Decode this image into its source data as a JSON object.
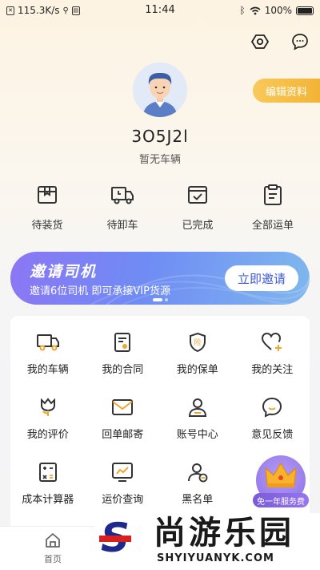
{
  "status_bar": {
    "speed": "115.3K/s",
    "time": "11:44",
    "battery": "100%"
  },
  "header": {
    "edit_profile": "编辑资料"
  },
  "profile": {
    "username": "3O5J2l",
    "vehicle_status": "暂无车辆"
  },
  "orders": [
    {
      "label": "待装货",
      "icon": "package-box-icon"
    },
    {
      "label": "待卸车",
      "icon": "truck-clock-icon"
    },
    {
      "label": "已完成",
      "icon": "check-box-icon"
    },
    {
      "label": "全部运单",
      "icon": "clipboard-list-icon"
    }
  ],
  "banner": {
    "title": "邀请司机",
    "subtitle": "邀请6位司机 即可承接VIP货源",
    "button": "立即邀请",
    "slide_count": 2,
    "active_slide": 1
  },
  "services": [
    {
      "label": "我的车辆",
      "icon": "truck-icon"
    },
    {
      "label": "我的合同",
      "icon": "contract-icon"
    },
    {
      "label": "我的保单",
      "icon": "insurance-shield-icon",
      "badge": "险"
    },
    {
      "label": "我的关注",
      "icon": "heart-plus-icon"
    },
    {
      "label": "我的评价",
      "icon": "tulip-icon"
    },
    {
      "label": "回单邮寄",
      "icon": "envelope-icon"
    },
    {
      "label": "账号中心",
      "icon": "user-account-icon"
    },
    {
      "label": "意见反馈",
      "icon": "feedback-chat-icon"
    },
    {
      "label": "成本计算器",
      "icon": "calculator-icon"
    },
    {
      "label": "运价查询",
      "icon": "price-chart-icon"
    },
    {
      "label": "黑名单",
      "icon": "user-block-icon"
    }
  ],
  "promo": {
    "label": "免一年服务费"
  },
  "tabbar": {
    "home": "首页"
  },
  "watermark": {
    "brand": "尚游乐园",
    "domain": "SHYIYUANYK.COM"
  },
  "colors": {
    "accent": "#f3b436",
    "banner_purple": "#8c76f4",
    "icon": "#333333",
    "icon_accent": "#f0a531"
  }
}
